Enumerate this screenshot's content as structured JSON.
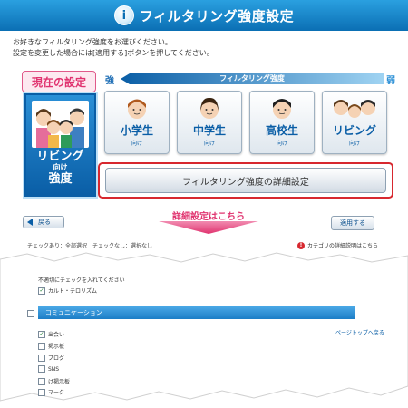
{
  "header": {
    "title": "フィルタリング強度設定",
    "icon": "info-icon"
  },
  "intro": {
    "line1": "お好きなフィルタリング強度をお選びください。",
    "line2": "設定を変更した場合には[適用する]ボタンを押してください。"
  },
  "current": {
    "tag": "現在の設定",
    "label_line1": "リビング",
    "label_small": "向け",
    "label_line2": "強度"
  },
  "strength": {
    "strong": "強",
    "weak": "弱",
    "label": "フィルタリング強度"
  },
  "levels": [
    {
      "name": "小学生",
      "sub": "向け"
    },
    {
      "name": "中学生",
      "sub": "向け"
    },
    {
      "name": "高校生",
      "sub": "向け"
    },
    {
      "name": "リビング",
      "sub": "向け"
    }
  ],
  "advanced_button": "フィルタリング強度の詳細設定",
  "detail_here": "詳細設定はこちら",
  "nav": {
    "back": "戻る",
    "apply": "適用する"
  },
  "check_links": "チェックあり：全部選択　チェックなし：選択なし",
  "help_link": "カテゴリの詳細説明はこちら",
  "partial": {
    "notice": "不適切にチェックを入れてください",
    "cult": "カルト・テロリズム",
    "category": "コミュニケーション",
    "page_top": "ページトップへ戻る",
    "items": [
      "出会い",
      "掲示板",
      "ブログ",
      "SNS",
      "け掲示板",
      "マーク"
    ]
  },
  "colors": {
    "header": "#0b6fb4",
    "accent": "#e0336f",
    "highlight": "#d7282f"
  }
}
